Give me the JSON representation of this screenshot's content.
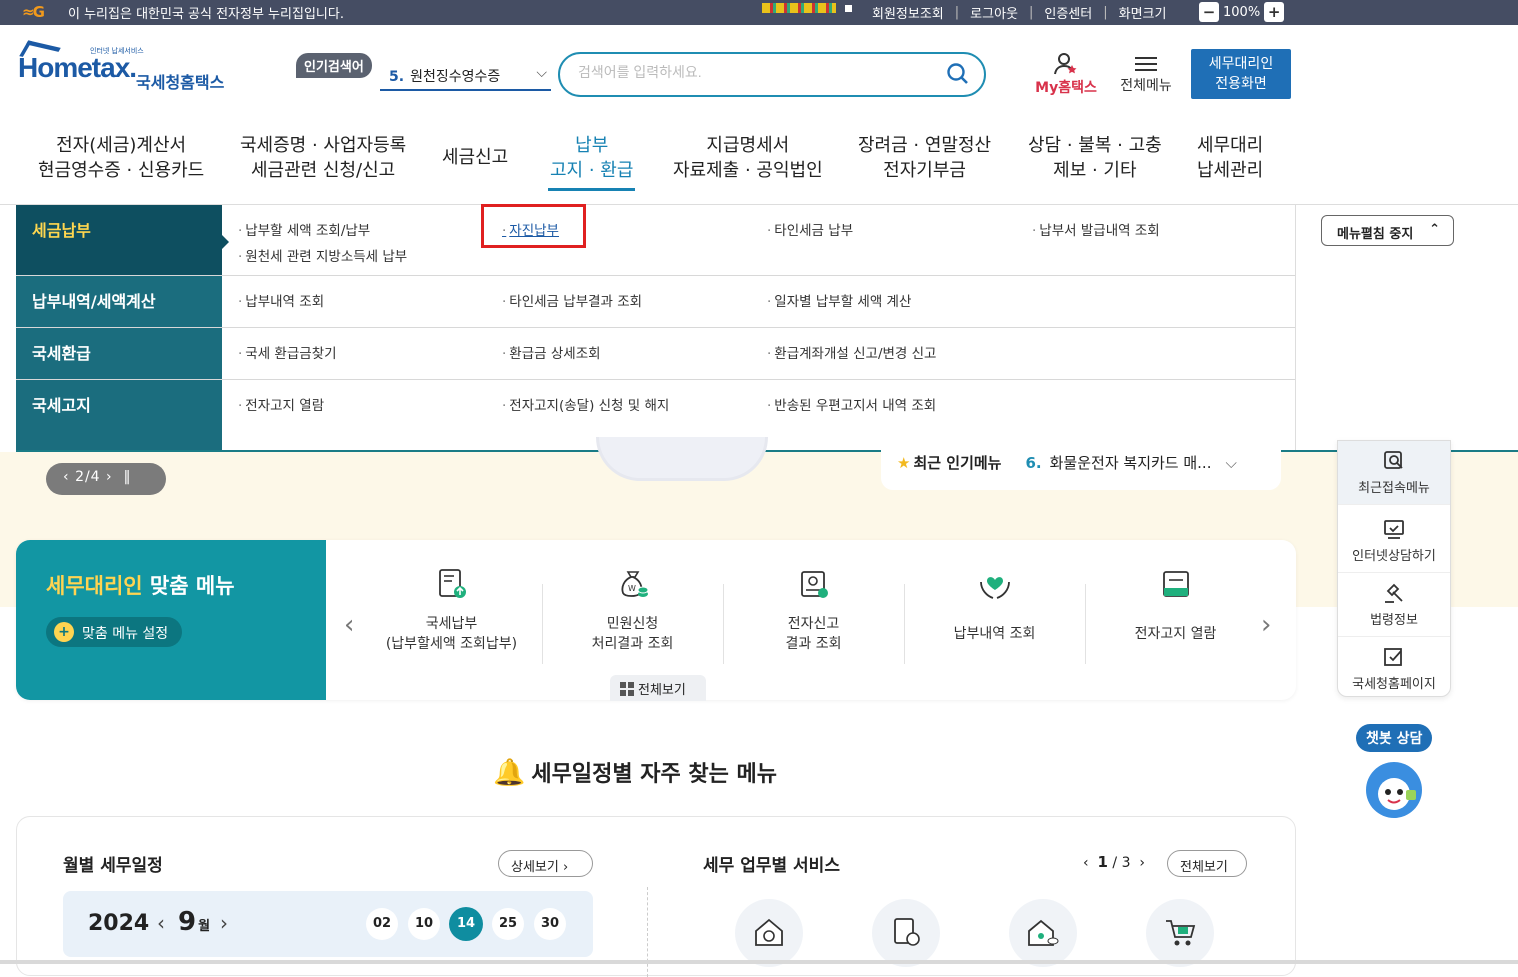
{
  "gov_bar": {
    "notice": "이 누리집은 대한민국 공식 전자정부 누리집입니다.",
    "links": [
      "회원정보조회",
      "로그아웃",
      "인증센터",
      "화면크기"
    ],
    "zoom": "100%",
    "zoom_minus": "−",
    "zoom_plus": "+"
  },
  "header": {
    "logo_text": "Hometax.",
    "logo_kr": "국세청홈택스",
    "logo_small": "인터넷 납세서비스",
    "popular_tag": "인기검색어",
    "popular_rank": "5.",
    "popular_term": "원천징수영수증",
    "search_placeholder": "검색어를 입력하세요.",
    "my_home": "My홈택스",
    "all_menu": "전체메뉴",
    "agent_screen_line1": "세무대리인",
    "agent_screen_line2": "전용화면"
  },
  "gnb": [
    {
      "l1": "전자(세금)계산서",
      "l2": "현금영수증 · 신용카드"
    },
    {
      "l1": "국세증명 · 사업자등록",
      "l2": "세금관련 신청/신고"
    },
    {
      "l1": "세금신고",
      "l2": ""
    },
    {
      "l1": "납부",
      "l2": "고지 · 환급"
    },
    {
      "l1": "지급명세서",
      "l2": "자료제출 · 공익법인"
    },
    {
      "l1": "장려금 · 연말정산",
      "l2": "전자기부금"
    },
    {
      "l1": "상담 · 불복 · 고충",
      "l2": "제보 · 기타"
    },
    {
      "l1": "세무대리",
      "l2": "납세관리"
    }
  ],
  "dropdown": {
    "rows": [
      {
        "category": "세금납부",
        "links": [
          "납부할 세액 조회/납부",
          "원천세 관련 지방소득세 납부",
          "자진납부",
          "타인세금 납부",
          "납부서 발급내역 조회"
        ]
      },
      {
        "category": "납부내역/세액계산",
        "links": [
          "납부내역 조회",
          "타인세금 납부결과 조회",
          "일자별 납부할 세액 계산"
        ]
      },
      {
        "category": "국세환급",
        "links": [
          "국세 환급금찾기",
          "환급금 상세조회",
          "환급계좌개설 신고/변경 신고"
        ]
      },
      {
        "category": "국세고지",
        "links": [
          "전자고지 열람",
          "전자고지(송달) 신청 및 해지",
          "반송된 우편고지서 내역 조회"
        ]
      }
    ],
    "menu_stop": "메뉴펼침 중지"
  },
  "banner": {
    "slide_counter": "2/4",
    "popular_label": "최근 인기메뉴",
    "popular_rank": "6.",
    "popular_item": "화물운전자 복지카드 매..."
  },
  "quick_menu": [
    "최근접속메뉴",
    "인터넷상담하기",
    "법령정보",
    "국세청홈페이지"
  ],
  "chatbot_label": "챗봇 상담",
  "agent_menu": {
    "title_accent": "세무대리인",
    "title_rest": "맞춤 메뉴",
    "setting": "맞춤 메뉴 설정",
    "items": [
      {
        "l1": "국세납부",
        "l2": "(납부할세액 조회납부)"
      },
      {
        "l1": "민원신청",
        "l2": "처리결과 조회"
      },
      {
        "l1": "전자신고",
        "l2": "결과 조회"
      },
      {
        "l1": "납부내역 조회",
        "l2": ""
      },
      {
        "l1": "전자고지 열람",
        "l2": ""
      }
    ],
    "view_all": "전체보기"
  },
  "schedule_section_title": "세무일정별 자주 찾는 메뉴",
  "monthly": {
    "title": "월별 세무일정",
    "more": "상세보기",
    "year": "2024",
    "month": "9",
    "month_unit": "월",
    "days": [
      "02",
      "10",
      "14",
      "25",
      "30"
    ],
    "selected_day": "14"
  },
  "services": {
    "title": "세무 업무별 서비스",
    "page_current": "1",
    "page_total": "/ 3",
    "view_all": "전체보기"
  },
  "colors": {
    "brand_blue": "#1c5aa5",
    "teal": "#1296a3",
    "dropdown_side": "#1b6d7e",
    "highlight_red": "#e02020"
  }
}
